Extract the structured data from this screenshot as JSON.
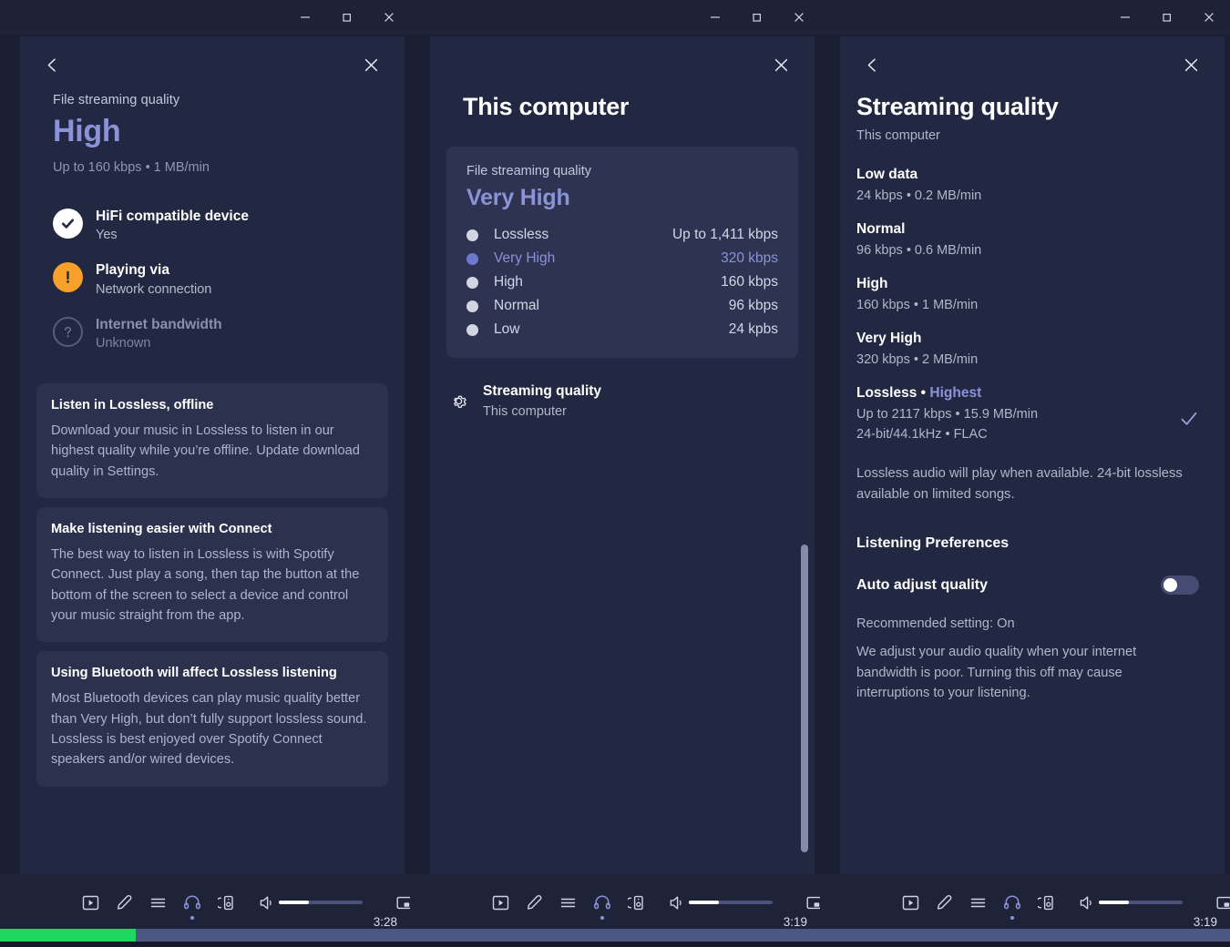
{
  "windows": {
    "controls": {
      "minimize": "minimize-button",
      "maximize": "maximize-button",
      "close": "close-button"
    }
  },
  "panel1": {
    "back": "Back",
    "close": "Close",
    "file_streaming_quality_label": "File streaming quality",
    "quality_value": "High",
    "quality_sub": "Up to 160 kbps • 1 MB/min",
    "status": [
      {
        "icon": "check-circle-icon",
        "title": "HiFi compatible device",
        "value": "Yes",
        "state": "ok"
      },
      {
        "icon": "warning-circle-icon",
        "title": "Playing via",
        "value": "Network connection",
        "state": "warn"
      },
      {
        "icon": "question-circle-icon",
        "title": "Internet bandwidth",
        "value": "Unknown",
        "state": "unknown"
      }
    ],
    "cards": [
      {
        "title": "Listen in Lossless, offline",
        "text": "Download your music in Lossless to listen in our highest quality while you’re offline. Update download quality in Settings."
      },
      {
        "title": "Make listening easier with Connect",
        "text": "The best way to listen in Lossless is with Spotify Connect. Just play a song, then tap the button at the bottom of the screen to select a device and control your music straight from the app."
      },
      {
        "title": "Using Bluetooth will affect Lossless listening",
        "text": "Most Bluetooth devices can play music quality better than Very High, but don’t fully support lossless sound. Lossless is best enjoyed over Spotify Connect speakers and/or wired devices."
      }
    ],
    "player": {
      "time": "3:28",
      "volume_percent": 36,
      "seek_percent": 33,
      "seek_color": "#1ed760"
    }
  },
  "panel2": {
    "close": "Close",
    "title": "This computer",
    "box": {
      "label": "File streaming quality",
      "value": "Very High",
      "rows": [
        {
          "name": "Lossless",
          "rate": "Up to 1,411 kbps",
          "selected": false
        },
        {
          "name": "Very High",
          "rate": "320 kbps",
          "selected": true
        },
        {
          "name": "High",
          "rate": "160 kbps",
          "selected": false
        },
        {
          "name": "Normal",
          "rate": "96 kbps",
          "selected": false
        },
        {
          "name": "Low",
          "rate": "24 kpbs",
          "selected": false
        }
      ]
    },
    "streaming_quality_row": {
      "icon": "gear-icon",
      "title": "Streaming quality",
      "sub": "This computer"
    },
    "player": {
      "time": "3:19",
      "volume_percent": 36,
      "seek_percent": 100,
      "seek_color": "#4d5783"
    }
  },
  "panel3": {
    "back": "Back",
    "close": "Close",
    "title": "Streaming quality",
    "subtitle": "This computer",
    "qualities": [
      {
        "name": "Low data",
        "badge": "",
        "meta": "24 kbps • 0.2 MB/min",
        "meta2": "",
        "checked": false
      },
      {
        "name": "Normal",
        "badge": "",
        "meta": "96 kbps • 0.6 MB/min",
        "meta2": "",
        "checked": false
      },
      {
        "name": "High",
        "badge": "",
        "meta": "160 kbps • 1 MB/min",
        "meta2": "",
        "checked": false
      },
      {
        "name": "Very High",
        "badge": "",
        "meta": "320 kbps • 2 MB/min",
        "meta2": "",
        "checked": false
      },
      {
        "name": "Lossless",
        "badge": "Highest",
        "meta": "Up to 2117 kbps • 15.9 MB/min",
        "meta2": "24-bit/44.1kHz • FLAC",
        "checked": true
      }
    ],
    "lossless_note": "Lossless audio will play when available. 24-bit lossless available on limited songs.",
    "preferences_title": "Listening Preferences",
    "auto_adjust_label": "Auto adjust quality",
    "auto_adjust_on": false,
    "recommended": "Recommended setting: On",
    "pref_description": "We adjust your audio quality when your internet bandwidth is poor. Turning this off may cause interruptions to your listening.",
    "player": {
      "time": "3:19",
      "volume_percent": 36,
      "seek_percent": 100,
      "seek_color": "#4d5783"
    }
  },
  "player_icons": [
    {
      "name": "now-playing-view-icon",
      "active": false
    },
    {
      "name": "lyrics-microphone-icon",
      "active": false
    },
    {
      "name": "queue-icon",
      "active": false
    },
    {
      "name": "headphones-icon",
      "active": true
    },
    {
      "name": "connect-to-device-icon",
      "active": false
    },
    {
      "name": "volume-icon",
      "active": false
    },
    {
      "name": "picture-in-picture-icon",
      "active": false
    },
    {
      "name": "fullscreen-icon",
      "active": false
    }
  ],
  "colors": {
    "accent_blue": "#8a93d8",
    "warn_orange": "#f7a02b",
    "progress_green": "#1ed760",
    "panel_bg": "#232842",
    "card_bg": "#2c314d"
  }
}
